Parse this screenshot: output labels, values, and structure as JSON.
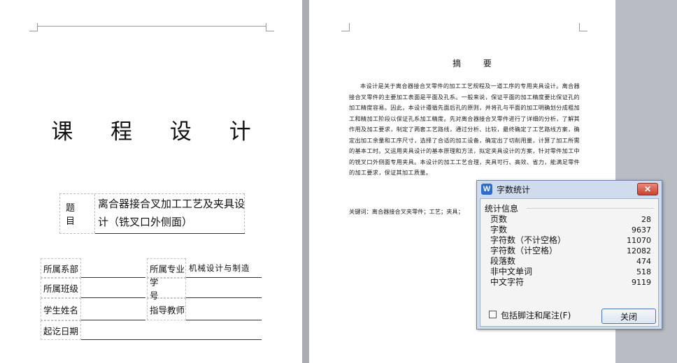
{
  "cover": {
    "title": "课 程 设 计",
    "topic_label": "题 目",
    "topic_value": "离合器接合叉加工工艺及夹具设计（铣叉口外侧面）",
    "fields": {
      "dept_label": "所属系部",
      "major_label": "所属专业",
      "major_value": "机械设计与制造",
      "class_label": "所属班级",
      "student_no_label": "学 号",
      "name_label": "学生姓名",
      "advisor_label": "指导教师",
      "date_label": "起讫日期"
    }
  },
  "abstract": {
    "title": "摘 要",
    "body": "本设计是关于离合器接合叉零件的加工工艺规程及一道工序的专用夹具设计。离合器接合叉零件的主要加工表面是平面及孔系。一般来说，保证平面的加工精度要比保证孔的加工精度容易。因此，本设计遵循先面后孔的原则，并将孔与平面的加工明确划分成粗加工和精加工阶段以保证孔系加工精度。先对离合器接合叉零件进行了详细的分析，了解其作用及加工要求，制定了两套工艺路线，通过分析、比较，最终确定了工艺路线方案，确定出加工余量和工序尺寸，选择了合适的加工设备，确定出了切削用量，计算了加工所需的基本工时。又运用夹具设计的基本原理和方法，拟定夹具设计的方案，针对零件加工中的铣叉口外侧面专用夹具。本设计的加工工艺合理，夹具可行、高效、省力，能满足零件的加工要求，保证其加工质量。",
    "keywords": "关键词：离合器接合叉夹零件；工艺；夹具；"
  },
  "dialog": {
    "title": "字数统计",
    "close_glyph": "✕",
    "group_label": "统计信息",
    "stats": [
      {
        "name": "页数",
        "value": "28"
      },
      {
        "name": "字数",
        "value": "9637"
      },
      {
        "name": "字符数（不计空格）",
        "value": "11070"
      },
      {
        "name": "字符数（计空格）",
        "value": "12082"
      },
      {
        "name": "段落数",
        "value": "474"
      },
      {
        "name": "非中文单词",
        "value": "518"
      },
      {
        "name": "中文字符",
        "value": "9119"
      }
    ],
    "checkbox_label": "包括脚注和尾注(F)",
    "close_button": "关闭"
  },
  "colors": {
    "workspace": "#a9acb3",
    "dialog_frame": "#cfdcee",
    "close_red": "#c8432e",
    "accent": "#2d6cc7"
  }
}
